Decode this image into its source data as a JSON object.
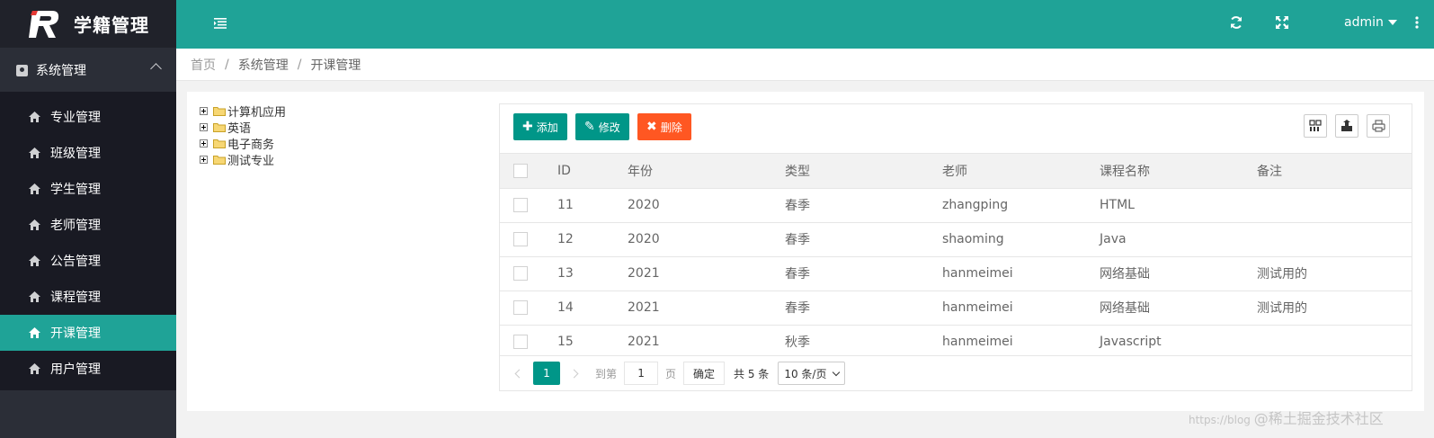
{
  "app": {
    "title": "学籍管理"
  },
  "sidebar": {
    "group_label": "系统管理",
    "items": [
      {
        "label": "专业管理",
        "active": false
      },
      {
        "label": "班级管理",
        "active": false
      },
      {
        "label": "学生管理",
        "active": false
      },
      {
        "label": "老师管理",
        "active": false
      },
      {
        "label": "公告管理",
        "active": false
      },
      {
        "label": "课程管理",
        "active": false
      },
      {
        "label": "开课管理",
        "active": true
      },
      {
        "label": "用户管理",
        "active": false
      }
    ]
  },
  "header": {
    "username": "admin",
    "icons": [
      "menu-toggle-icon",
      "refresh-icon",
      "fullscreen-icon",
      "more-vertical-icon"
    ]
  },
  "breadcrumb": [
    "首页",
    "系统管理",
    "开课管理"
  ],
  "tree": {
    "nodes": [
      "计算机应用",
      "英语",
      "电子商务",
      "测试专业"
    ]
  },
  "toolbar": {
    "add_label": "添加",
    "edit_label": "修改",
    "delete_label": "删除",
    "icons": [
      "columns-icon",
      "export-icon",
      "print-icon"
    ]
  },
  "table": {
    "headers": [
      "ID",
      "年份",
      "类型",
      "老师",
      "课程名称",
      "备注"
    ],
    "rows": [
      {
        "id": "11",
        "year": "2020",
        "type": "春季",
        "teacher": "zhangping",
        "course": "HTML",
        "note": ""
      },
      {
        "id": "12",
        "year": "2020",
        "type": "春季",
        "teacher": "shaoming",
        "course": "Java",
        "note": ""
      },
      {
        "id": "13",
        "year": "2021",
        "type": "春季",
        "teacher": "hanmeimei",
        "course": "网络基础",
        "note": "测试用的"
      },
      {
        "id": "14",
        "year": "2021",
        "type": "春季",
        "teacher": "hanmeimei",
        "course": "网络基础",
        "note": "测试用的"
      },
      {
        "id": "15",
        "year": "2021",
        "type": "秋季",
        "teacher": "hanmeimei",
        "course": "Javascript",
        "note": ""
      }
    ]
  },
  "pager": {
    "current": "1",
    "goto_prefix": "到第",
    "goto_value": "1",
    "goto_suffix": "页",
    "confirm_label": "确定",
    "total_text": "共 5 条",
    "page_size": "10 条/页"
  },
  "watermark": {
    "url": "https://blog",
    "site": "@稀土掘金技术社区"
  },
  "colors": {
    "primary": "#1fa397",
    "button": "#009688",
    "danger": "#ff5722",
    "sidebar": "#20222a"
  }
}
